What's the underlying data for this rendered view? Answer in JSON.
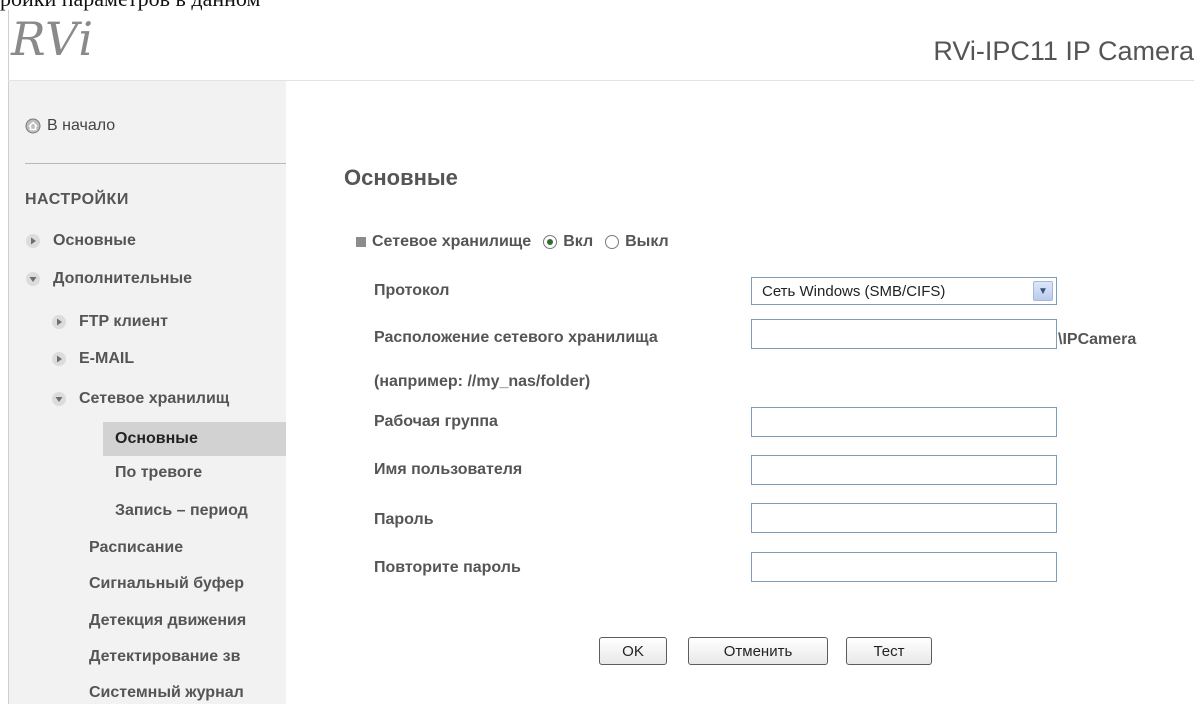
{
  "caption": "ройки параметров в данном",
  "header": {
    "logo": "RVi",
    "title": "RVi-IPC11 IP Camera"
  },
  "sidebar": {
    "home_label": "В начало",
    "section_title": "НАСТРОЙКИ",
    "items": [
      {
        "label": "Основные"
      },
      {
        "label": "Дополнительные"
      },
      {
        "label": "FTP клиент"
      },
      {
        "label": "E-MAIL"
      },
      {
        "label": "Сетевое хранилищ"
      },
      {
        "label": "Основные"
      },
      {
        "label": "По тревоге"
      },
      {
        "label": "Запись – период"
      },
      {
        "label": "Расписание"
      },
      {
        "label": "Сигнальный буфер"
      },
      {
        "label": "Детекция движения"
      },
      {
        "label": "Детектирование зв"
      },
      {
        "label": "Системный журнал"
      }
    ]
  },
  "main": {
    "title": "Основные",
    "storage": {
      "label": "Сетевое хранилище",
      "on_label": "Вкл",
      "off_label": "Выкл",
      "selected": "Вкл"
    },
    "protocol": {
      "label": "Протокол",
      "value": "Сеть Windows (SMB/CIFS)"
    },
    "location": {
      "label": "Расположение сетевого хранилища",
      "value": "",
      "suffix": "\\IPCamera",
      "hint": "(например: //my_nas/folder)"
    },
    "workgroup": {
      "label": "Рабочая группа",
      "value": ""
    },
    "username": {
      "label": "Имя пользователя",
      "value": ""
    },
    "password": {
      "label": "Пароль",
      "value": ""
    },
    "password_repeat": {
      "label": "Повторите пароль",
      "value": ""
    },
    "buttons": {
      "ok": "OK",
      "cancel": "Отменить",
      "test": "Тест"
    }
  },
  "colors": {
    "active_menu_bg": "#d2d2d2",
    "sidebar_bg": "#f2f2f2",
    "input_border": "#7f9db9"
  }
}
